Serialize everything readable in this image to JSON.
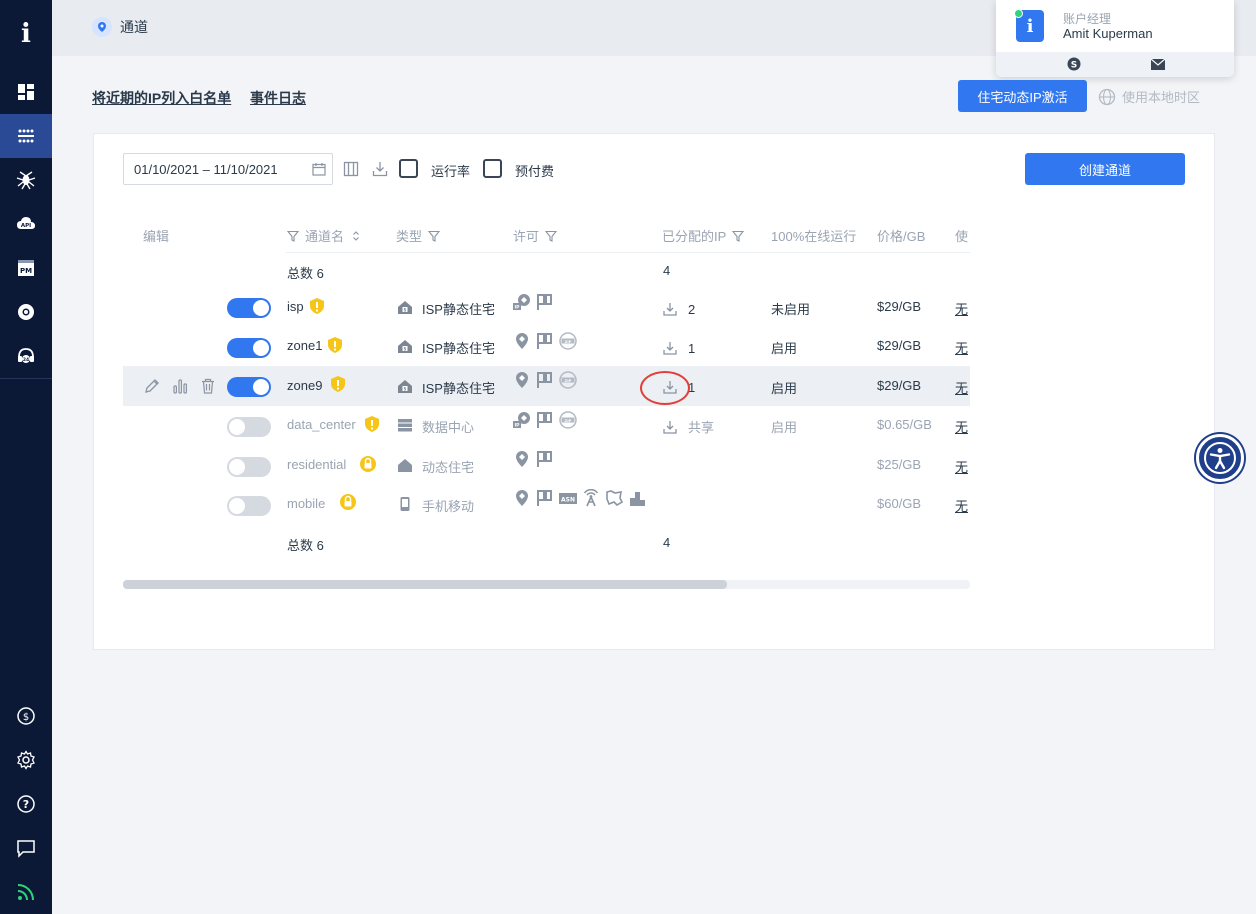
{
  "sidebar": {
    "logo": "i",
    "items": [
      {
        "name": "dashboard-icon"
      },
      {
        "name": "zones-icon",
        "active": true
      },
      {
        "name": "spider-icon"
      },
      {
        "name": "api-icon"
      },
      {
        "name": "proxy-manager-icon"
      },
      {
        "name": "chrome-extension-icon"
      },
      {
        "name": "support-24-icon"
      }
    ],
    "bottom": [
      {
        "name": "billing-icon"
      },
      {
        "name": "settings-icon"
      },
      {
        "name": "help-icon"
      },
      {
        "name": "chat-icon"
      },
      {
        "name": "feed-icon"
      }
    ]
  },
  "breadcrumb": {
    "label": "通道"
  },
  "account": {
    "role": "账户经理",
    "name": "Amit Kuperman"
  },
  "subheader": {
    "whitelist_link": "将近期的IP列入白名单",
    "events_link": "事件日志",
    "activate_button": "住宅动态IP激活",
    "timezone_label": "使用本地时区"
  },
  "toolbar": {
    "date_range": "01/10/2021 – 11/10/2021",
    "uptime_label": "运行率",
    "prepaid_label": "预付费",
    "create_button": "创建通道"
  },
  "table": {
    "headers": {
      "edit": "编辑",
      "name": "通道名",
      "type": "类型",
      "permission": "许可",
      "assigned_ips": "已分配的IP",
      "uptime": "100%在线运行",
      "price": "价格/GB",
      "usage": "使"
    },
    "total_label": "总数 6",
    "total_ips": "4",
    "rows": [
      {
        "name": "isp",
        "enabled": true,
        "badge": "shield",
        "type": "ISP静态住宅",
        "ips": "2",
        "uptime": "未启用",
        "price": "$29/GB",
        "usage": "无"
      },
      {
        "name": "zone1",
        "enabled": true,
        "badge": "shield",
        "type": "ISP静态住宅",
        "ips": "1",
        "uptime": "启用",
        "price": "$29/GB",
        "usage": "无"
      },
      {
        "name": "zone9",
        "enabled": true,
        "badge": "shield",
        "type": "ISP静态住宅",
        "ips": "1",
        "uptime": "启用",
        "price": "$29/GB",
        "usage": "无"
      },
      {
        "name": "data_center",
        "enabled": false,
        "badge": "shield",
        "type": "数据中心",
        "ips": "共享",
        "uptime": "启用",
        "price": "$0.65/GB",
        "usage": "无"
      },
      {
        "name": "residential",
        "enabled": false,
        "badge": "lock",
        "type": "动态住宅",
        "ips": "",
        "uptime": "",
        "price": "$25/GB",
        "usage": "无"
      },
      {
        "name": "mobile",
        "enabled": false,
        "badge": "lock",
        "type": "手机移动",
        "ips": "",
        "uptime": "",
        "price": "$60/GB",
        "usage": "无"
      }
    ]
  },
  "colors": {
    "accent": "#3178f0",
    "sidebar": "#0b1836",
    "badge": "#f5c518",
    "highlight": "#e0403a"
  }
}
